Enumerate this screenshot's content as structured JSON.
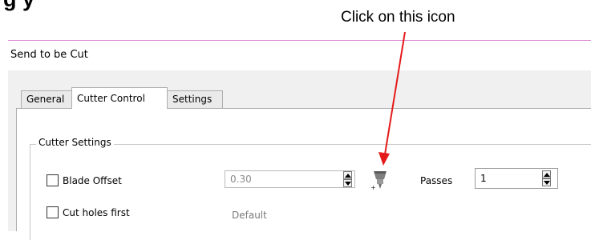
{
  "heading_fragment": "g   y",
  "callout": "Click on this icon",
  "callout_color": "#e41a1a",
  "dialog": {
    "title": "Send to be Cut",
    "tabs": [
      {
        "label": "General"
      },
      {
        "label": "Cutter Control",
        "selected": true
      },
      {
        "label": "Settings"
      }
    ],
    "group": {
      "legend": "Cutter Settings",
      "blade_offset": {
        "label": "Blade Offset",
        "checked": false,
        "value": "0.30",
        "enabled": false,
        "icon": "blade-offset-calibration-icon"
      },
      "passes": {
        "label": "Passes",
        "value": "1"
      },
      "cut_holes_first": {
        "label": "Cut holes first",
        "checked": false
      },
      "default_text": "Default"
    }
  }
}
